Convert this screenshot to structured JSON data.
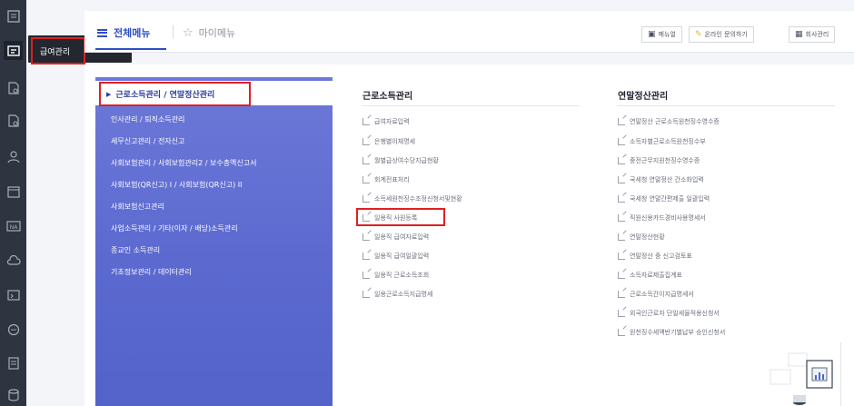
{
  "sidebar": {
    "icons": [
      "ledger-icon",
      "payroll-icon",
      "document-settings-icon",
      "document-settings-icon",
      "person-icon",
      "calendar-icon",
      "na-icon",
      "cloud-icon",
      "terminal-icon",
      "chat-icon",
      "list-icon",
      "database-icon"
    ],
    "active_index": 1,
    "flyout_label": "급여관리"
  },
  "header": {
    "all_menu_label": "전체메뉴",
    "my_menu_label": "마이메뉴",
    "buttons": {
      "manual": "메뉴얼",
      "inquiry": "온라인 문의하기",
      "company": "회사관리"
    }
  },
  "categories": {
    "active": "근로소득관리 / 연말정산관리",
    "items": [
      "인사관리 / 퇴직소득관리",
      "세무신고관리 / 전자신고",
      "사회보험관리 / 사회보험관리2 / 보수총액신고서",
      "사회보험(QR신고) I / 사회보험(QR신고) II",
      "사회보험신고관리",
      "사업소득관리 / 기타(이자 / 배당)소득관리",
      "종교인 소득관리",
      "기초정보관리 / 데이터관리"
    ]
  },
  "columns": {
    "left": {
      "title": "근로소득관리",
      "items": [
        "급여자료입력",
        "은행별이체명세",
        "월별급상여수당지급현황",
        "회계전표처리",
        "소득세원천징수조정신청서및현황",
        "일용직 사원등록",
        "일용직 급여자료입력",
        "일용직 급여일괄입력",
        "일용직 근로소득조회",
        "일용근로소득지급명세"
      ]
    },
    "right": {
      "title": "연말정산관리",
      "items": [
        "연말정산 근로소득원천징수영수증",
        "소득자별근로소득원천징수부",
        "중전근무지원천징수영수증",
        "국세청 연말정산 간소화입력",
        "국세청 연말간편제출 일괄입력",
        "직원신용카드경비사용명세서",
        "연말정산현황",
        "연말정산 중 신고검토표",
        "소득자료제출집계표",
        "근로소득간이지급명세서",
        "외국인근로자 단일세율적용신청서",
        "원천징수세액반기별납부 승인신청서"
      ]
    }
  },
  "colors": {
    "rail": "#2f3441",
    "accent": "#2d4ec5",
    "highlight_border": "#e02020",
    "category_pane": "#5c6ad0"
  }
}
